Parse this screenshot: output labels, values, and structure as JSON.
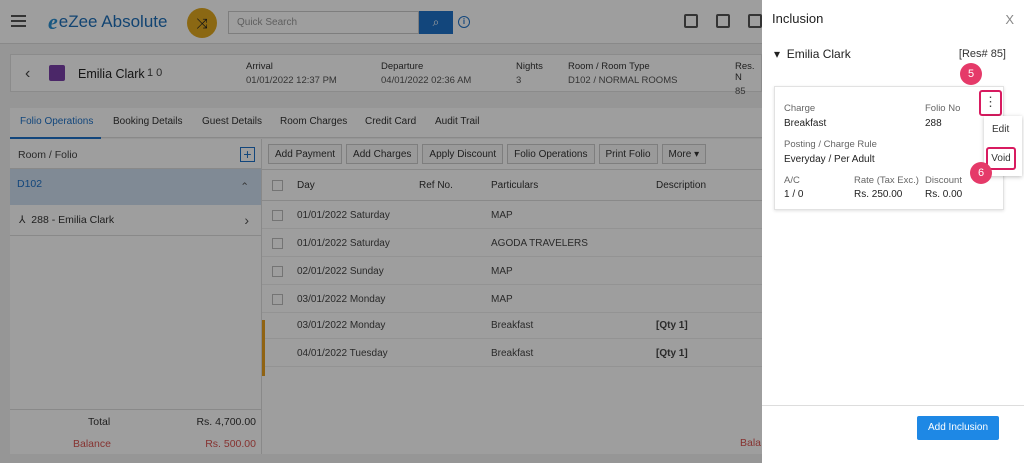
{
  "app": {
    "logo_mark": "e",
    "logo_text": "eZee Absolute",
    "search_placeholder": "Quick Search",
    "info": "i"
  },
  "reservation": {
    "guest": "Emilia Clark",
    "pax": "1  0",
    "arrival_label": "Arrival",
    "arrival": "01/01/2022 12:37 PM",
    "departure_label": "Departure",
    "departure": "04/01/2022 02:36 AM",
    "nights_label": "Nights",
    "nights": "3",
    "room_label": "Room / Room Type",
    "room": "D102 / NORMAL ROOMS",
    "res_label": "Res. N",
    "res": "85"
  },
  "tabs": [
    "Folio Operations",
    "Booking Details",
    "Guest Details",
    "Room Charges",
    "Credit Card",
    "Audit Trail"
  ],
  "left": {
    "header": "Room / Folio",
    "room": "D102",
    "folio": "288 - Emilia Clark",
    "total_label": "Total",
    "total": "Rs. 4,700.00",
    "balance_label": "Balance",
    "balance": "Rs. 500.00"
  },
  "actions": [
    "Add Payment",
    "Add Charges",
    "Apply Discount",
    "Folio Operations",
    "Print Folio",
    "More ▾"
  ],
  "table": {
    "headers": [
      "Day",
      "Ref No.",
      "Particulars",
      "Description"
    ],
    "rows": [
      {
        "day": "01/01/2022 Saturday",
        "particulars": "MAP",
        "description": ""
      },
      {
        "day": "01/01/2022 Saturday",
        "particulars": "AGODA TRAVELERS",
        "description": ""
      },
      {
        "day": "02/01/2022 Sunday",
        "particulars": "MAP",
        "description": ""
      },
      {
        "day": "03/01/2022 Monday",
        "particulars": "MAP",
        "description": ""
      },
      {
        "day": "03/01/2022 Monday",
        "particulars": "Breakfast",
        "description": "[Qty 1]"
      },
      {
        "day": "04/01/2022 Tuesday",
        "particulars": "Breakfast",
        "description": "[Qty 1]"
      }
    ],
    "bottom_label": "Bala"
  },
  "panel": {
    "title": "Inclusion",
    "close": "X",
    "guest": "Emilia Clark",
    "res": "[Res# 85]",
    "charge_label": "Charge",
    "charge": "Breakfast",
    "folio_label": "Folio No",
    "folio": "288",
    "rule_label": "Posting / Charge Rule",
    "rule": "Everyday / Per Adult",
    "ac_label": "A/C",
    "ac": "1 / 0",
    "rate_label": "Rate (Tax Exc.)",
    "rate": "Rs. 250.00",
    "disc_label": "Discount",
    "disc": "Rs. 0.00",
    "menu_edit": "Edit",
    "menu_void": "Void",
    "badge5": "5",
    "badge6": "6",
    "kebab": "⋮",
    "add_button": "Add Inclusion"
  }
}
